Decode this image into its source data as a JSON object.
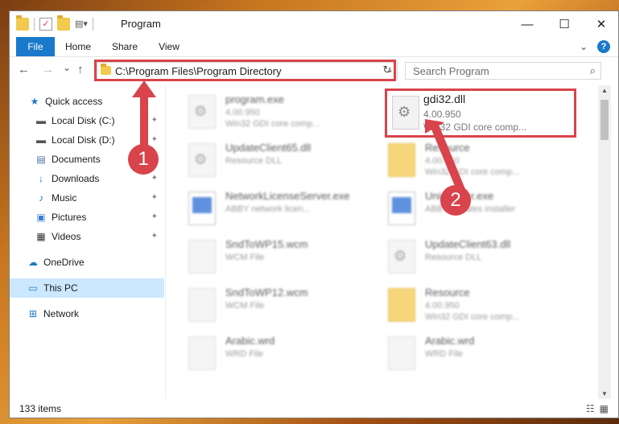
{
  "window": {
    "title": "Program",
    "controls": {
      "minimize": "—",
      "maximize": "☐",
      "close": "✕"
    }
  },
  "ribbon": {
    "tabs": [
      "File",
      "Home",
      "Share",
      "View"
    ],
    "expand_icon": "chevron-down-icon",
    "help_label": "?"
  },
  "nav": {
    "back": "←",
    "forward": "→",
    "recent": "⌄",
    "up": "↑",
    "address": "C:\\Program Files\\Program Directory",
    "search_placeholder": "Search Program"
  },
  "sidebar": {
    "items": [
      {
        "label": "Quick access",
        "icon": "star-icon",
        "glyph": "★",
        "pinned": false
      },
      {
        "label": "Local Disk (C:)",
        "icon": "drive-icon",
        "glyph": "▬",
        "pinned": true
      },
      {
        "label": "Local Disk (D:)",
        "icon": "drive-icon",
        "glyph": "▬",
        "pinned": true
      },
      {
        "label": "Documents",
        "icon": "documents-icon",
        "glyph": "▤",
        "pinned": true
      },
      {
        "label": "Downloads",
        "icon": "download-icon",
        "glyph": "↓",
        "pinned": true
      },
      {
        "label": "Music",
        "icon": "music-icon",
        "glyph": "♪",
        "pinned": true
      },
      {
        "label": "Pictures",
        "icon": "pictures-icon",
        "glyph": "▣",
        "pinned": true
      },
      {
        "label": "Videos",
        "icon": "videos-icon",
        "glyph": "▦",
        "pinned": true
      },
      {
        "label": "OneDrive",
        "icon": "cloud-icon",
        "glyph": "☁",
        "pinned": false
      },
      {
        "label": "This PC",
        "icon": "computer-icon",
        "glyph": "▭",
        "pinned": false
      },
      {
        "label": "Network",
        "icon": "network-icon",
        "glyph": "⊞",
        "pinned": false
      }
    ],
    "pin_glyph": "📌"
  },
  "files": {
    "col1": [
      {
        "name": "program.exe",
        "line2": "4.00.950",
        "line3": "Win32 GDI core comp...",
        "kind": "gear"
      },
      {
        "name": "UpdateClient65.dll",
        "line2": "Resource DLL",
        "line3": "",
        "kind": "gear"
      },
      {
        "name": "NetworkLicenseServer.exe",
        "line2": "ABBY network licen...",
        "line3": "",
        "kind": "app"
      },
      {
        "name": "SndToWP15.wcm",
        "line2": "WCM File",
        "line3": "",
        "kind": "doc"
      },
      {
        "name": "SndToWP12.wcm",
        "line2": "WCM File",
        "line3": "",
        "kind": "doc"
      },
      {
        "name": "Arabic.wrd",
        "line2": "WRD File",
        "line3": "",
        "kind": "doc"
      }
    ],
    "col2": [
      {
        "name": "Resource",
        "line2": "4.00.950",
        "line3": "Win32 GDI core comp...",
        "kind": "fold"
      },
      {
        "name": "Uninstaller.exe",
        "line2": "ABBY updates installer",
        "line3": "",
        "kind": "app"
      },
      {
        "name": "UpdateClient63.dll",
        "line2": "Resource DLL",
        "line3": "",
        "kind": "gear"
      },
      {
        "name": "Resource",
        "line2": "4.00.950",
        "line3": "Win32 GDI core comp...",
        "kind": "fold"
      },
      {
        "name": "Arabic.wrd",
        "line2": "WRD File",
        "line3": "",
        "kind": "doc"
      }
    ],
    "highlighted": {
      "name": "gdi32.dll",
      "line2": "4.00.950",
      "line3": "Win32 GDI core comp..."
    }
  },
  "status": {
    "item_count": "133 items",
    "view_details": "☷",
    "view_icons": "▦"
  },
  "annotations": {
    "step1": "1",
    "step2": "2",
    "color": "#d9434b"
  }
}
